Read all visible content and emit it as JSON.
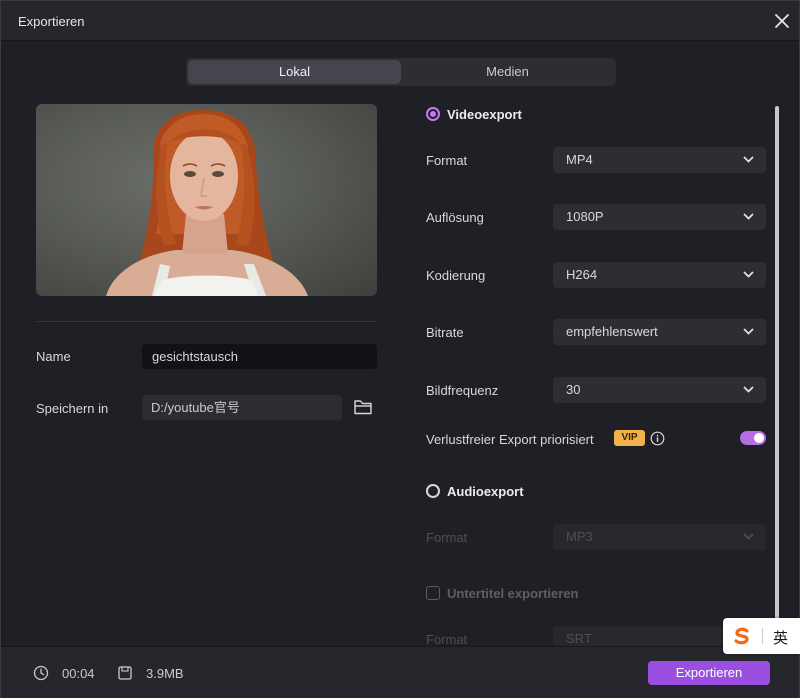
{
  "window": {
    "title": "Exportieren"
  },
  "tabs": [
    {
      "label": "Lokal",
      "active": true
    },
    {
      "label": "Medien",
      "active": false
    }
  ],
  "left": {
    "name_label": "Name",
    "name_value": "gesichtstausch",
    "save_label": "Speichern in",
    "save_path": "D:/youtube官号"
  },
  "video": {
    "title": "Videoexport",
    "selected": true,
    "rows": [
      {
        "label": "Format",
        "value": "MP4"
      },
      {
        "label": "Auflösung",
        "value": "1080P"
      },
      {
        "label": "Kodierung",
        "value": "H264"
      },
      {
        "label": "Bitrate",
        "value": "empfehlenswert"
      },
      {
        "label": "Bildfrequenz",
        "value": "30"
      }
    ],
    "lossless_label": "Verlustfreier Export priorisiert",
    "vip_badge": "VIP",
    "lossless_on": true
  },
  "audio": {
    "title": "Audioexport",
    "selected": false,
    "format_label": "Format",
    "format_value": "MP3"
  },
  "subtitles": {
    "title": "Untertitel exportieren",
    "checked": false,
    "format_label": "Format",
    "format_value": "SRT"
  },
  "ime": {
    "lang": "英"
  },
  "footer": {
    "duration": "00:04",
    "size": "3.9MB",
    "export_label": "Exportieren"
  },
  "colors": {
    "accent": "#9b4fe0",
    "radio_accent": "#c47af0",
    "vip": "#f2b14a",
    "toggle_on": "#b56ee6",
    "background": "#1f2025"
  }
}
